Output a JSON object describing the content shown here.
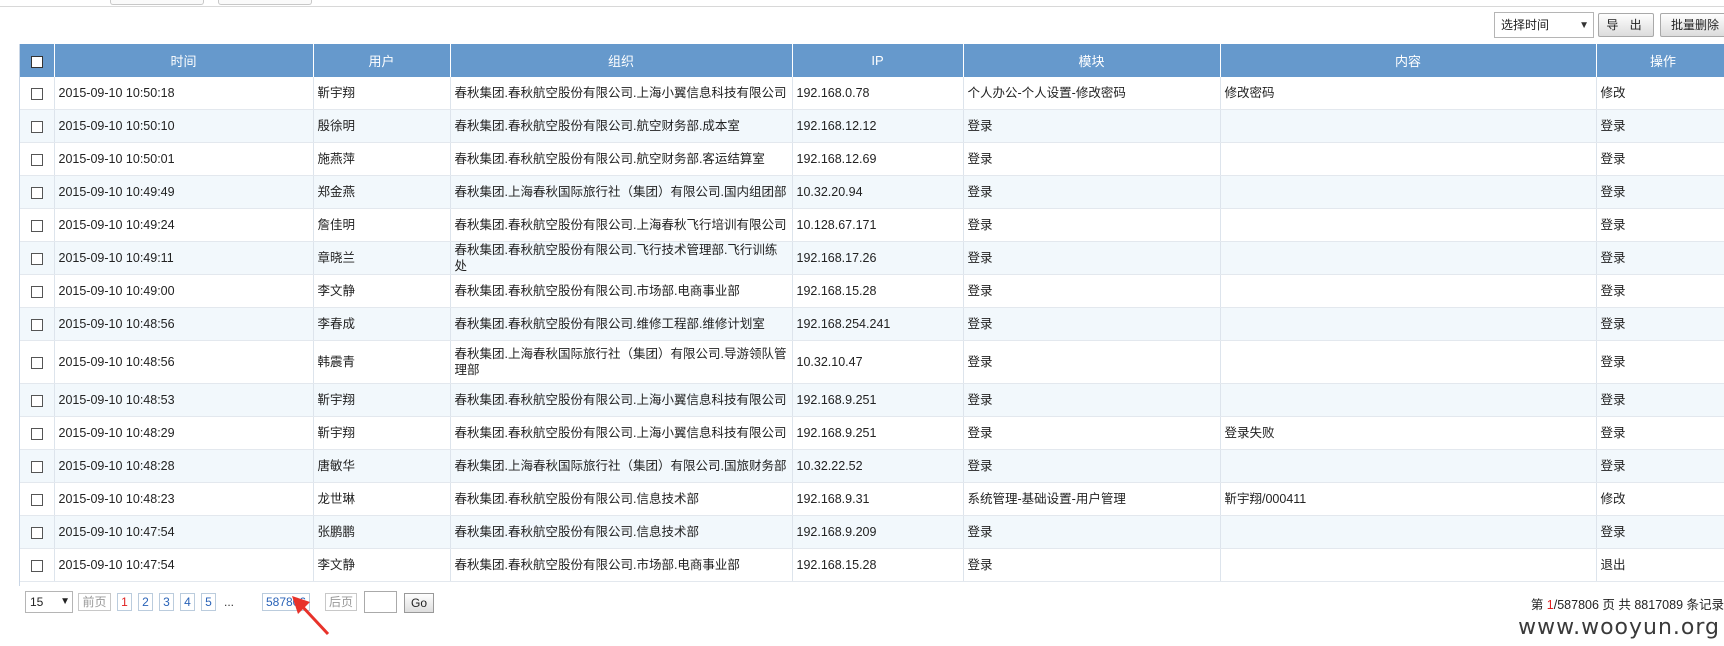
{
  "toolbar": {
    "time_select": "选择时间",
    "export_label": "导 出",
    "batch_delete_label": "批量删除"
  },
  "table": {
    "headers": [
      "时间",
      "用户",
      "组织",
      "IP",
      "模块",
      "内容",
      "操作"
    ],
    "rows": [
      {
        "time": "2015-09-10 10:50:18",
        "user": "靳宇翔",
        "org": "春秋集团.春秋航空股份有限公司.上海小翼信息科技有限公司",
        "ip": "192.168.0.78",
        "module": "个人办公-个人设置-修改密码",
        "content": "修改密码",
        "action": "修改"
      },
      {
        "time": "2015-09-10 10:50:10",
        "user": "殷徐明",
        "org": "春秋集团.春秋航空股份有限公司.航空财务部.成本室",
        "ip": "192.168.12.12",
        "module": "登录",
        "content": "",
        "action": "登录"
      },
      {
        "time": "2015-09-10 10:50:01",
        "user": "施燕萍",
        "org": "春秋集团.春秋航空股份有限公司.航空财务部.客运结算室",
        "ip": "192.168.12.69",
        "module": "登录",
        "content": "",
        "action": "登录"
      },
      {
        "time": "2015-09-10 10:49:49",
        "user": "郑金燕",
        "org": "春秋集团.上海春秋国际旅行社（集团）有限公司.国内组团部",
        "ip": "10.32.20.94",
        "module": "登录",
        "content": "",
        "action": "登录"
      },
      {
        "time": "2015-09-10 10:49:24",
        "user": "詹佳明",
        "org": "春秋集团.春秋航空股份有限公司.上海春秋飞行培训有限公司",
        "ip": "10.128.67.171",
        "module": "登录",
        "content": "",
        "action": "登录"
      },
      {
        "time": "2015-09-10 10:49:11",
        "user": "章晓兰",
        "org": "春秋集团.春秋航空股份有限公司.飞行技术管理部.飞行训练处",
        "ip": "192.168.17.26",
        "module": "登录",
        "content": "",
        "action": "登录"
      },
      {
        "time": "2015-09-10 10:49:00",
        "user": "李文静",
        "org": "春秋集团.春秋航空股份有限公司.市场部.电商事业部",
        "ip": "192.168.15.28",
        "module": "登录",
        "content": "",
        "action": "登录"
      },
      {
        "time": "2015-09-10 10:48:56",
        "user": "李春成",
        "org": "春秋集团.春秋航空股份有限公司.维修工程部.维修计划室",
        "ip": "192.168.254.241",
        "module": "登录",
        "content": "",
        "action": "登录"
      },
      {
        "time": "2015-09-10 10:48:56",
        "user": "韩震青",
        "org": "春秋集团.上海春秋国际旅行社（集团）有限公司.导游领队管理部",
        "ip": "10.32.10.47",
        "module": "登录",
        "content": "",
        "action": "登录"
      },
      {
        "time": "2015-09-10 10:48:53",
        "user": "靳宇翔",
        "org": "春秋集团.春秋航空股份有限公司.上海小翼信息科技有限公司",
        "ip": "192.168.9.251",
        "module": "登录",
        "content": "",
        "action": "登录"
      },
      {
        "time": "2015-09-10 10:48:29",
        "user": "靳宇翔",
        "org": "春秋集团.春秋航空股份有限公司.上海小翼信息科技有限公司",
        "ip": "192.168.9.251",
        "module": "登录",
        "content": "登录失败",
        "action": "登录"
      },
      {
        "time": "2015-09-10 10:48:28",
        "user": "唐敏华",
        "org": "春秋集团.上海春秋国际旅行社（集团）有限公司.国旅财务部",
        "ip": "10.32.22.52",
        "module": "登录",
        "content": "",
        "action": "登录"
      },
      {
        "time": "2015-09-10 10:48:23",
        "user": "龙世琳",
        "org": "春秋集团.春秋航空股份有限公司.信息技术部",
        "ip": "192.168.9.31",
        "module": "系统管理-基础设置-用户管理",
        "content": "靳宇翔/000411",
        "action": "修改"
      },
      {
        "time": "2015-09-10 10:47:54",
        "user": "张鹏鹏",
        "org": "春秋集团.春秋航空股份有限公司.信息技术部",
        "ip": "192.168.9.209",
        "module": "登录",
        "content": "",
        "action": "登录"
      },
      {
        "time": "2015-09-10 10:47:54",
        "user": "李文静",
        "org": "春秋集团.春秋航空股份有限公司.市场部.电商事业部",
        "ip": "192.168.15.28",
        "module": "登录",
        "content": "",
        "action": "退出"
      }
    ]
  },
  "pager": {
    "page_size": "15",
    "prev": "前页",
    "pages": [
      "1",
      "2",
      "3",
      "4",
      "5"
    ],
    "dots": "...",
    "last_page": "587806",
    "next": "后页",
    "go": "Go",
    "info_prefix": "第 ",
    "info_current": "1",
    "info_suffix": "/587806 页  共 8817089 条记录"
  },
  "watermark": "www.wooyun.org",
  "colors": {
    "header_bg": "#6699cc",
    "row_alt": "#f2f8fc",
    "link": "#2a63b8",
    "current_page": "#e02020",
    "annotation_arrow": "#e8322a"
  }
}
